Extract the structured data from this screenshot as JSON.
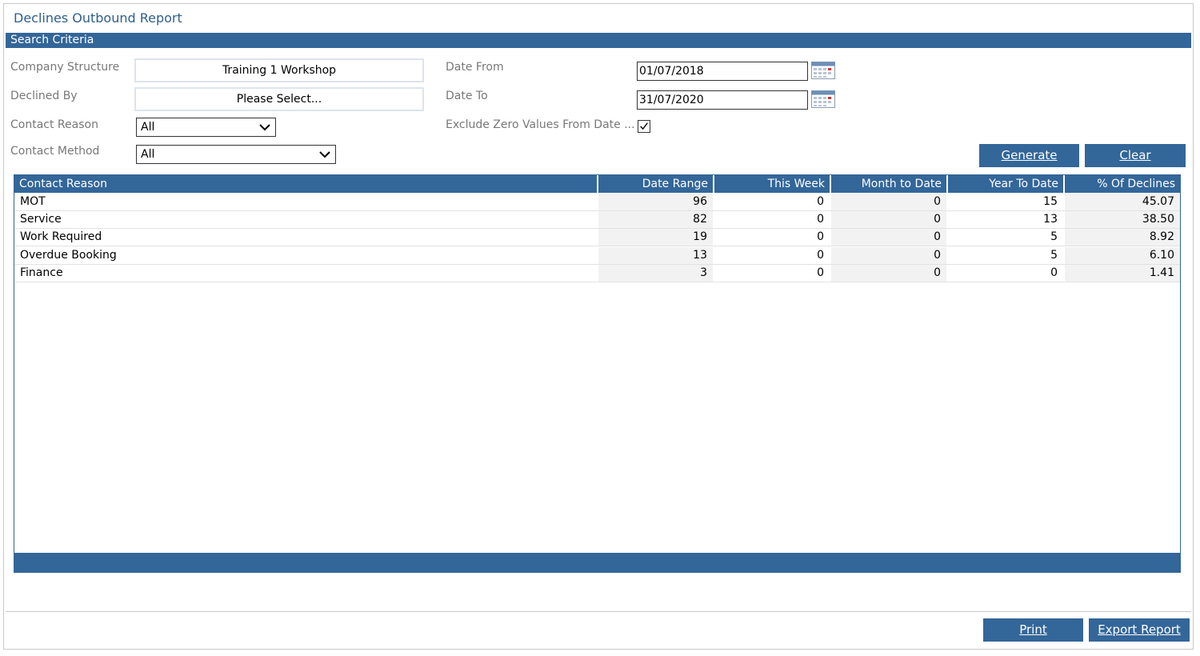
{
  "page": {
    "title": "Declines Outbound Report"
  },
  "search": {
    "section_title": "Search Criteria",
    "company_structure": {
      "label": "Company Structure",
      "value": "Training 1 Workshop"
    },
    "declined_by": {
      "label": "Declined By",
      "value": "Please Select..."
    },
    "contact_reason": {
      "label": "Contact Reason",
      "value": "All"
    },
    "contact_method": {
      "label": "Contact Method",
      "value": "All"
    },
    "date_from": {
      "label": "Date From",
      "value": "01/07/2018"
    },
    "date_to": {
      "label": "Date To",
      "value": "31/07/2020"
    },
    "exclude_zero": {
      "label": "Exclude Zero Values From Date ...",
      "checked": true
    },
    "generate_label": "Generate",
    "clear_label": "Clear"
  },
  "table": {
    "columns": [
      "Contact Reason",
      "Date Range",
      "This Week",
      "Month to Date",
      "Year To Date",
      "% Of Declines"
    ],
    "rows": [
      [
        "MOT",
        "96",
        "0",
        "0",
        "15",
        "45.07"
      ],
      [
        "Service",
        "82",
        "0",
        "0",
        "13",
        "38.50"
      ],
      [
        "Work Required",
        "19",
        "0",
        "0",
        "5",
        "8.92"
      ],
      [
        "Overdue Booking",
        "13",
        "0",
        "0",
        "5",
        "6.10"
      ],
      [
        "Finance",
        "3",
        "0",
        "0",
        "0",
        "1.41"
      ]
    ]
  },
  "footer": {
    "print_label": "Print",
    "export_label": "Export Report"
  },
  "colors": {
    "accent": "#336699",
    "title": "#2e5f8e"
  }
}
